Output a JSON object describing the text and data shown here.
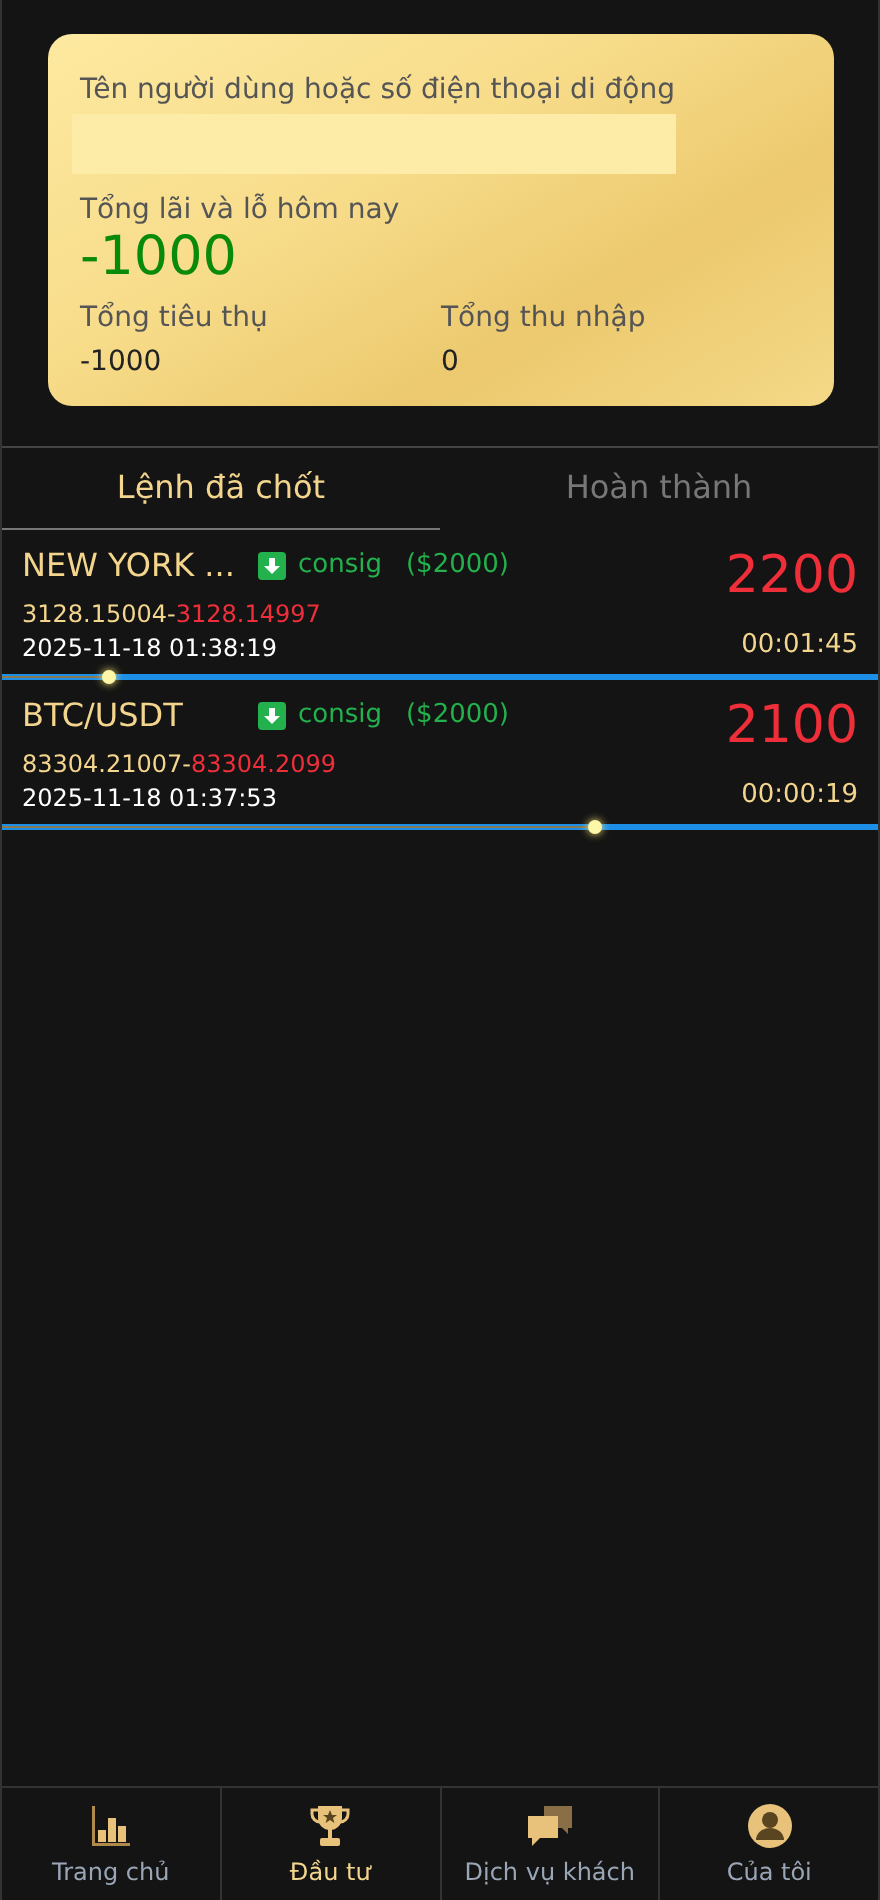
{
  "summary": {
    "user_label": "Tên người dùng hoặc số điện thoại di động",
    "pnl_label": "Tổng lãi và lỗ hôm nay",
    "pnl_value": "-1000",
    "spent_label": "Tổng tiêu thụ",
    "spent_value": "-1000",
    "income_label": "Tổng thu nhập",
    "income_value": "0"
  },
  "tabs": [
    {
      "label": "Lệnh đã chốt",
      "selected": true
    },
    {
      "label": "Hoàn thành",
      "selected": false
    }
  ],
  "orders": [
    {
      "symbol": "NEW YORK ...",
      "type": "consig",
      "amount": "($2000)",
      "open_price": "3128.15004-",
      "close_price": "3128.14997",
      "time": "2025-11-18 01:38:19",
      "result": "2200",
      "countdown": "00:01:45",
      "level": 0.12
    },
    {
      "symbol": "BTC/USDT",
      "type": "consig",
      "amount": "($2000)",
      "open_price": "83304.21007-",
      "close_price": "83304.2099",
      "time": "2025-11-18 01:37:53",
      "result": "2100",
      "countdown": "00:00:19",
      "level": 0.675
    }
  ],
  "nav": [
    {
      "label": "Trang chủ",
      "selected": false
    },
    {
      "label": "Đầu tư",
      "selected": true
    },
    {
      "label": "Dịch vụ khách",
      "selected": false
    },
    {
      "label": "Của tôi",
      "selected": false
    }
  ]
}
